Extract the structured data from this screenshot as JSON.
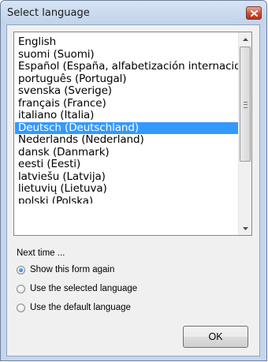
{
  "window": {
    "title": "Select language"
  },
  "language_list": {
    "items": [
      "English",
      "suomi (Suomi)",
      "Español (España, alfabetización internacional)",
      "português (Portugal)",
      "svenska (Sverige)",
      "français (France)",
      "italiano (Italia)",
      "Deutsch (Deutschland)",
      "Nederlands (Nederland)",
      "dansk (Danmark)",
      "eesti (Eesti)",
      "latviešu (Latvija)",
      "lietuvių (Lietuva)",
      "polski (Polska)"
    ],
    "selected": "Deutsch (Deutschland)"
  },
  "next_time": {
    "label": "Next time ...",
    "options": [
      {
        "label": "Show this form again",
        "checked": true
      },
      {
        "label": "Use the selected language",
        "checked": false
      },
      {
        "label": "Use the default language",
        "checked": false
      }
    ]
  },
  "buttons": {
    "ok_label": "OK"
  },
  "colors": {
    "selection": "#3399ff",
    "titlebar": "#c5d6ec",
    "close_button": "#c84d37"
  },
  "icons": {
    "close": "close-icon",
    "scroll_up": "chevron-up-icon",
    "scroll_down": "chevron-down-icon"
  }
}
